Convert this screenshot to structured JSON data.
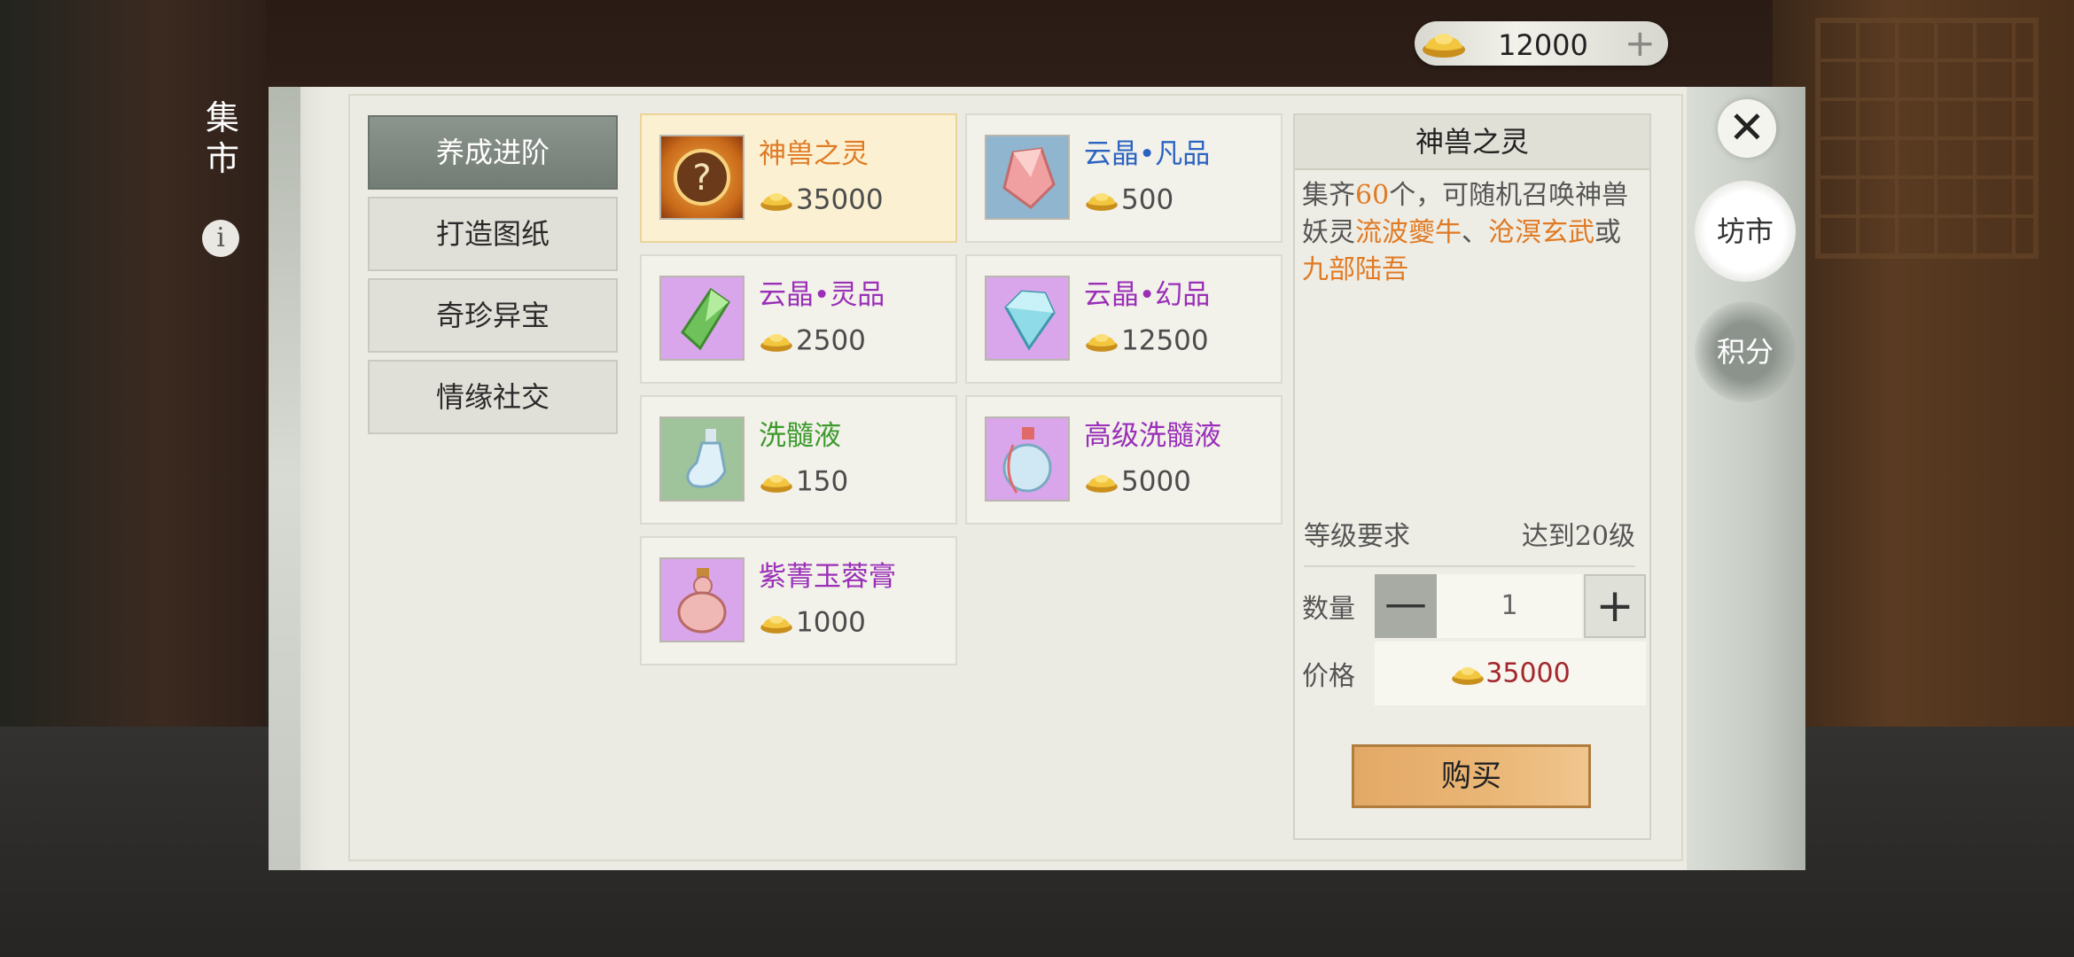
{
  "currency": {
    "amount": "12000",
    "add_label": "+"
  },
  "header": {
    "market_title": "集市",
    "info_label": "i"
  },
  "categories": [
    {
      "label": "养成进阶",
      "active": true
    },
    {
      "label": "打造图纸",
      "active": false
    },
    {
      "label": "奇珍异宝",
      "active": false
    },
    {
      "label": "情缘社交",
      "active": false
    }
  ],
  "items": [
    {
      "name": "神兽之灵",
      "price": "35000",
      "name_color": "#e07a24",
      "selected": true
    },
    {
      "name": "云晶•凡品",
      "price": "500",
      "name_color": "#2a63c2"
    },
    {
      "name": "云晶•灵品",
      "price": "2500",
      "name_color": "#9a2fb8"
    },
    {
      "name": "云晶•幻品",
      "price": "12500",
      "name_color": "#9a2fb8"
    },
    {
      "name": "洗髓液",
      "price": "150",
      "name_color": "#3c9a2c"
    },
    {
      "name": "高级洗髓液",
      "price": "5000",
      "name_color": "#9a2fb8"
    },
    {
      "name": "紫菁玉蓉膏",
      "price": "1000",
      "name_color": "#9a2fb8"
    }
  ],
  "detail": {
    "title": "神兽之灵",
    "desc_1": "集齐",
    "desc_count": "60",
    "desc_2": "个，可随机召唤神兽妖灵",
    "beast_1": "流波夔牛",
    "sep_1": "、",
    "beast_2": "沧溟玄武",
    "sep_2": "或",
    "beast_3": "九部陆吾",
    "level_label": "等级要求",
    "level_value": "达到20级",
    "qty_label": "数量",
    "qty_value": "1",
    "minus_label": "—",
    "plus_label": "+",
    "price_label": "价格",
    "price_value": "35000",
    "buy_label": "购买"
  },
  "side_tabs": [
    {
      "label": "坊市",
      "active": true
    },
    {
      "label": "积分",
      "active": false
    }
  ],
  "close_label": "✕"
}
